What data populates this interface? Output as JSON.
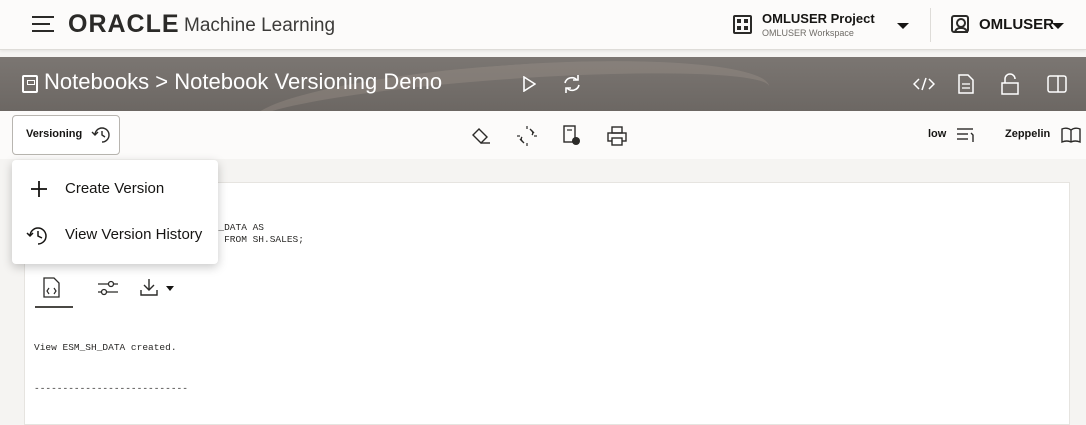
{
  "header": {
    "brand": "ORACLE",
    "app_name": "Machine Learning",
    "project": {
      "title": "OMLUSER Project",
      "workspace": "OMLUSER Workspace"
    },
    "user": "OMLUSER"
  },
  "titlebar": {
    "breadcrumb": "Notebooks > Notebook Versioning Demo",
    "icons": [
      "run-icon",
      "refresh-icon",
      "code-view-icon",
      "document-icon",
      "lock-icon",
      "split-view-icon"
    ]
  },
  "toolbar": {
    "versioning_label": "Versioning",
    "icons": [
      "eraser-icon",
      "unlink-icon",
      "notebook-settings-icon",
      "print-icon"
    ],
    "service_level": "low",
    "interpreter": "Zeppelin"
  },
  "version_menu": {
    "items": [
      {
        "label": "Create Version",
        "icon": "plus-icon"
      },
      {
        "label": "View Version History",
        "icon": "history-icon"
      }
    ]
  },
  "paragraph": {
    "code_lines": [
      "SH_DATA AS",
      "LD FROM SH.SALES;"
    ],
    "output_tabs": [
      "code-file-icon",
      "settings-sliders-icon",
      "download-icon"
    ],
    "result": "View ESM_SH_DATA created.",
    "separator": "---------------------------"
  }
}
